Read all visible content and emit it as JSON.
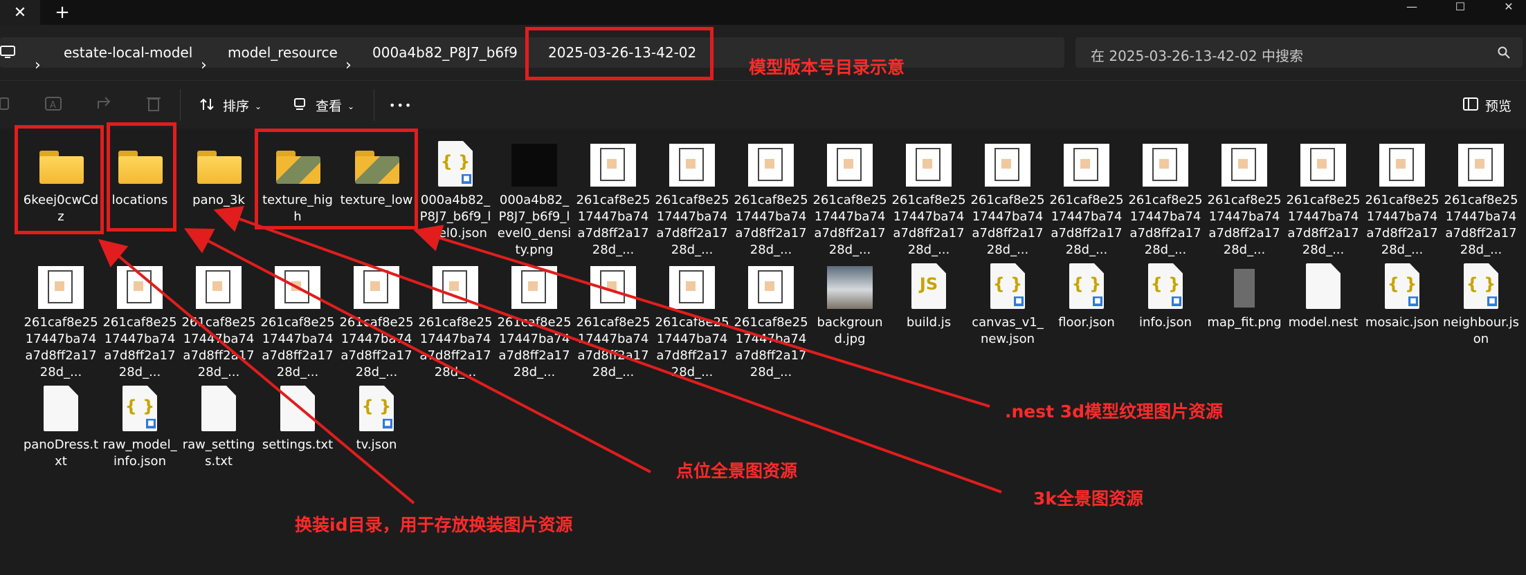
{
  "window": {
    "tab_close": "✕",
    "new_tab": "+",
    "minimize": "—",
    "maximize": "☐",
    "close": "✕"
  },
  "breadcrumbs": [
    "estate-local-model",
    "model_resource",
    "000a4b82_P8J7_b6f9",
    "2025-03-26-13-42-02"
  ],
  "search": {
    "placeholder": "在 2025-03-26-13-42-02 中搜索"
  },
  "toolbar": {
    "sort": "排序",
    "view": "查看",
    "more": "•••",
    "preview": "预览"
  },
  "files": {
    "row1": [
      "6keej0cwCdz",
      "locations",
      "pano_3k",
      "texture_high",
      "texture_low",
      "000a4b82_P8J7_b6f9_level0.json",
      "000a4b82_P8J7_b6f9_level0_density.png",
      "261caf8e2517447ba74a7d8ff2a1728d_...",
      "261caf8e2517447ba74a7d8ff2a1728d_...",
      "261caf8e2517447ba74a7d8ff2a1728d_...",
      "261caf8e2517447ba74a7d8ff2a1728d_...",
      "261caf8e2517447ba74a7d8ff2a1728d_...",
      "261caf8e2517447ba74a7d8ff2a1728d_...",
      "261caf8e2517447ba74a7d8ff2a1728d_...",
      "261caf8e2517447ba74a7d8ff2a1728d_...",
      "261caf8e2517447ba74a7d8ff2a1728d_...",
      "261caf8e2517447ba74a7d8ff2a1728d_...",
      "261caf8e2517447ba74a7d8ff2a1728d_...",
      "261caf8e2517447ba74a7d8ff2a1728d_..."
    ],
    "row2": [
      "261caf8e2517447ba74a7d8ff2a1728d_...",
      "261caf8e2517447ba74a7d8ff2a1728d_...",
      "261caf8e2517447ba74a7d8ff2a1728d_...",
      "261caf8e2517447ba74a7d8ff2a1728d_...",
      "261caf8e2517447ba74a7d8ff2a1728d_...",
      "261caf8e2517447ba74a7d8ff2a1728d_...",
      "261caf8e2517447ba74a7d8ff2a1728d_...",
      "261caf8e2517447ba74a7d8ff2a1728d_...",
      "261caf8e2517447ba74a7d8ff2a1728d_...",
      "261caf8e2517447ba74a7d8ff2a1728d_...",
      "background.jpg",
      "build.js",
      "canvas_v1_new.json",
      "floor.json",
      "info.json",
      "map_fit.png",
      "model.nest",
      "mosaic.json",
      "neighbour.json"
    ],
    "row3": [
      "panoDress.txt",
      "raw_model_info.json",
      "raw_settings.txt",
      "settings.txt",
      "tv.json"
    ]
  },
  "annotations": {
    "version_dir": "模型版本号目录示意",
    "nest_texture": ".nest 3d模型纹理图片资源",
    "locations_pano": "点位全景图资源",
    "pano_3k": "3k全景图资源",
    "dress_dir": "换装id目录，用于存放换装图片资源"
  },
  "colors": {
    "annotation_red": "#e11d1d",
    "folder_yellow": "#f3b832",
    "background": "#1c1c1c"
  }
}
